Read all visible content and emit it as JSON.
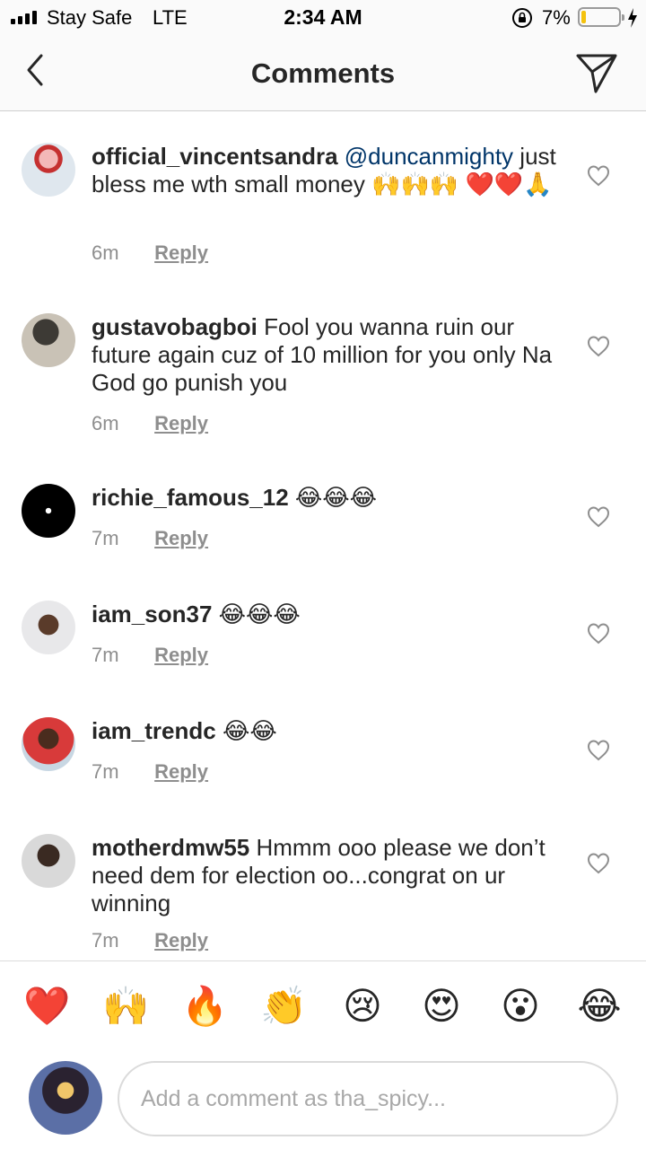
{
  "status_bar": {
    "carrier": "Stay Safe",
    "network": "LTE",
    "time": "2:34 AM",
    "battery_percent": "7%",
    "battery_level": 0.07
  },
  "header": {
    "title": "Comments"
  },
  "comments": [
    {
      "username": "official_vincentsandra",
      "mention": "@duncanmighty",
      "text": "just bless me wth small money 🙌🙌🙌 ❤️❤️🙏",
      "time": "6m",
      "reply_label": "Reply"
    },
    {
      "username": "gustavobagboi",
      "mention": "",
      "text": "Fool you wanna ruin our future again cuz of 10 million for you only Na God go punish you",
      "time": "6m",
      "reply_label": "Reply"
    },
    {
      "username": "richie_famous_12",
      "mention": "",
      "text": "😂😂😂",
      "time": "7m",
      "reply_label": "Reply"
    },
    {
      "username": "iam_son37",
      "mention": "",
      "text": "😂😂😂",
      "time": "7m",
      "reply_label": "Reply"
    },
    {
      "username": "iam_trendc",
      "mention": "",
      "text": "😂😂",
      "time": "7m",
      "reply_label": "Reply"
    },
    {
      "username": "motherdmw55",
      "mention": "",
      "text": "Hmmm ooo please we don’t need dem for election oo...congrat on ur winning",
      "time": "7m",
      "reply_label": "Reply"
    }
  ],
  "emoji_bar": [
    {
      "emoji": "❤️",
      "icon": "red-heart-emoji"
    },
    {
      "emoji": "🙌",
      "icon": "raising-hands-emoji"
    },
    {
      "emoji": "🔥",
      "icon": "fire-emoji"
    },
    {
      "emoji": "👏",
      "icon": "clapping-hands-emoji"
    },
    {
      "emoji": "😢",
      "icon": "crying-face-emoji"
    },
    {
      "emoji": "😍",
      "icon": "heart-eyes-emoji"
    },
    {
      "emoji": "😮",
      "icon": "surprised-face-emoji"
    },
    {
      "emoji": "😂",
      "icon": "tears-of-joy-emoji"
    }
  ],
  "composer": {
    "placeholder": "Add a comment as tha_spicy..."
  },
  "colors": {
    "text": "#262626",
    "secondary": "#8e8e8e",
    "mention": "#003569",
    "divider": "#dbdbdb",
    "battery_low": "#f4c20d"
  }
}
